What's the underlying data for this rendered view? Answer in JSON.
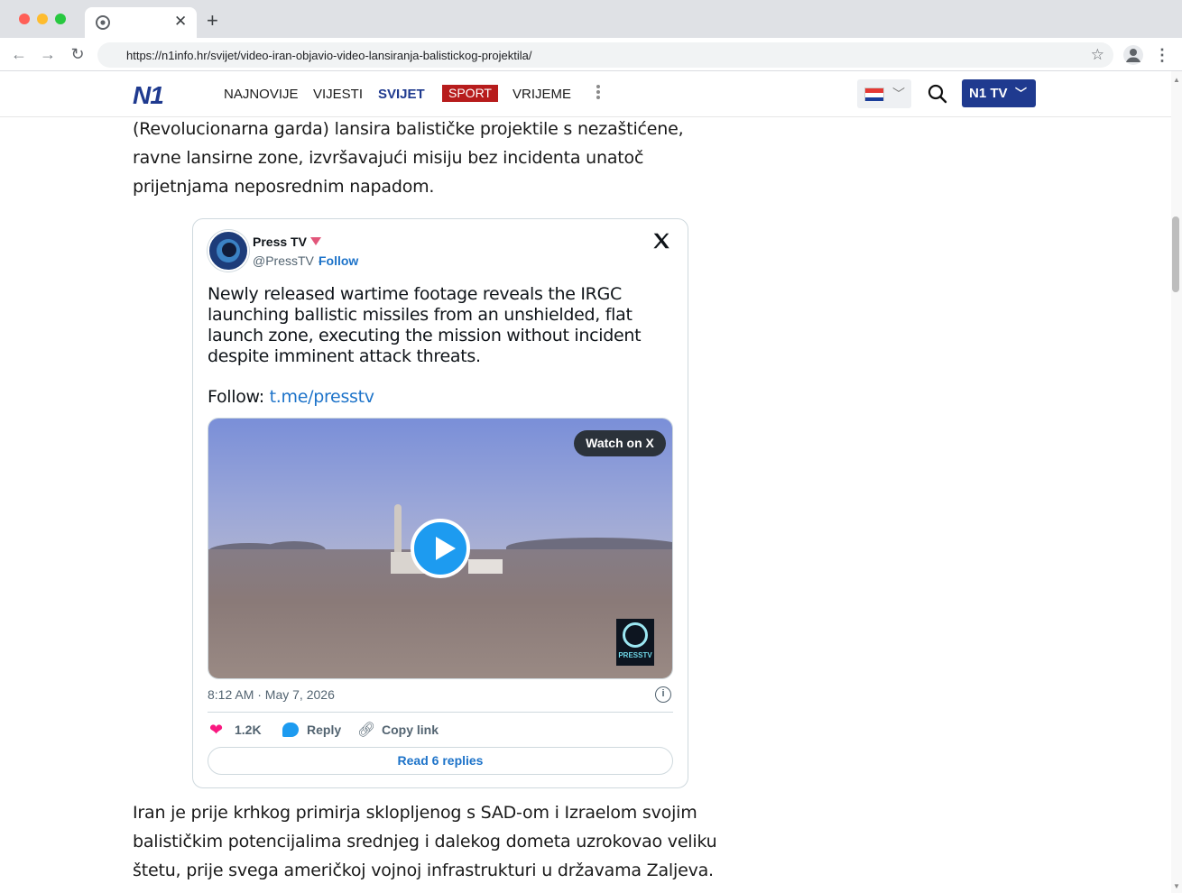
{
  "browser": {
    "tab_title": "",
    "tab_close": "✕",
    "new_tab": "+",
    "url": "https://n1info.hr/svijet/video-iran-objavio-video-lansiranja-balistickog-projektila/",
    "star_icon": "star-icon"
  },
  "site": {
    "logo": "N1",
    "nav": [
      "NAJNOVIJE",
      "VIJESTI",
      "SVIJET",
      "SPORT",
      "VRIJEME"
    ],
    "active_nav": "SVIJET",
    "sport_bg": "#b71c1c",
    "brand_color": "#1f3a8f",
    "tv_button": "N1 TV"
  },
  "article": {
    "para_top": "(Revolucionarna garda) lansira balističke projektile s nezaštićene, ravne lansirne zone, izvršavajući misiju bez incidenta unatoč prijetnjama neposrednim napadom.",
    "para_bottom": "Iran je prije krhkog primirja sklopljenog s SAD-om i Izraelom svojim balističkim potencijalima srednjeg i dalekog dometa uzrokovao veliku štetu, prije svega američkoj vojnoj infrastrukturi u državama Zaljeva."
  },
  "tweet": {
    "author": "Press TV",
    "handle": "@PressTV",
    "separator": "·",
    "follow": "Follow",
    "x_logo": "𝕏",
    "text": "Newly released wartime footage reveals the IRGC launching ballistic missiles from an unshielded, flat launch zone, executing the mission without incident despite imminent attack threats.",
    "follow_prefix": "Follow: ",
    "follow_link": "t.me/presstv",
    "watch_on_x": "Watch on X",
    "video_logo_text": "PRESSTV",
    "timestamp": "8:12 AM · May 7, 2026",
    "likes": "1.2K",
    "reply": "Reply",
    "copy_link": "Copy link",
    "read_replies": "Read 6 replies"
  }
}
